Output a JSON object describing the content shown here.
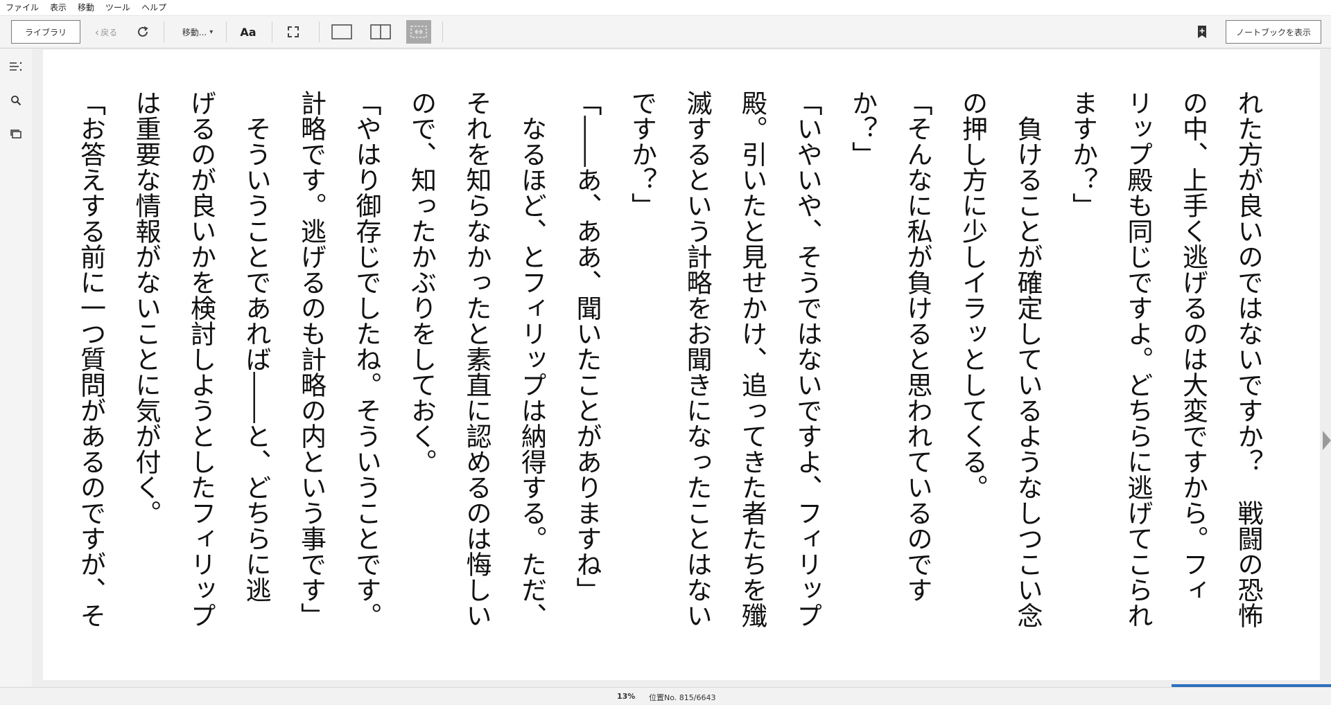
{
  "menu": [
    "ファイル",
    "表示",
    "移動",
    "ツール",
    "ヘルプ"
  ],
  "toolbar": {
    "library": "ライブラリ",
    "back": "戻る",
    "goto": "移動...",
    "font": "Aa",
    "notebook": "ノートブックを表示"
  },
  "page": {
    "lines": [
      "れた方が良いのではないですか？　戦闘の恐怖",
      "の中、上手く逃げるのは大変ですから。フィ",
      "リップ殿も同じですよ。どちらに逃げてこられ",
      "ますか？」",
      "　負けることが確定しているようなしつこい念",
      "の押し方に少しイラッとしてくる。",
      "「そんなに私が負けると思われているのです",
      "か？」",
      "「いやいや、そうではないですよ、フィリップ",
      "殿。引いたと見せかけ、追ってきた者たちを殲",
      "滅するという計略をお聞きになったことはない",
      "ですか？」",
      "「――あ、ああ、聞いたことがありますね」",
      "　なるほど、とフィリップは納得する。ただ、",
      "それを知らなかったと素直に認めるのは悔しい",
      "ので、知ったかぶりをしておく。",
      "「やはり御存じでしたね。そういうことです。",
      "計略です。逃げるのも計略の内という事です」",
      "　そういうことであれば――と、どちらに逃",
      "げるのが良いかを検討しようとしたフィリップ",
      "は重要な情報がないことに気が付く。",
      "「お答えする前に一つ質問があるのですが、そ"
    ]
  },
  "status": {
    "percent": "13%",
    "location": "位置No. 815/6643",
    "progress_fraction": 0.13
  },
  "colors": {
    "accent": "#2b6fbf"
  }
}
